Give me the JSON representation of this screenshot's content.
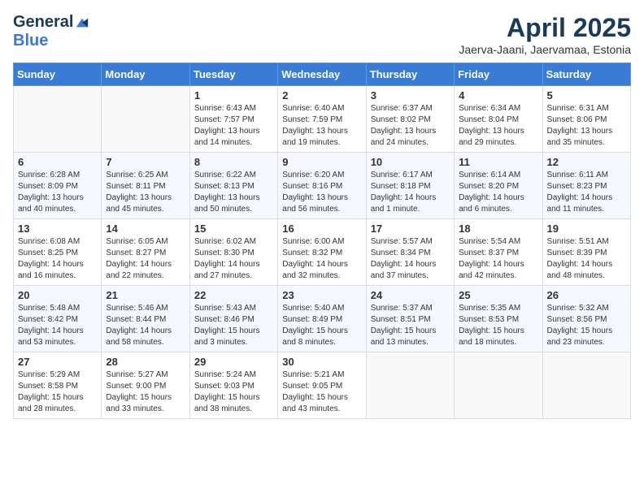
{
  "header": {
    "logo_general": "General",
    "logo_blue": "Blue",
    "month": "April 2025",
    "location": "Jaerva-Jaani, Jaervamaa, Estonia"
  },
  "weekdays": [
    "Sunday",
    "Monday",
    "Tuesday",
    "Wednesday",
    "Thursday",
    "Friday",
    "Saturday"
  ],
  "weeks": [
    [
      {
        "day": "",
        "info": ""
      },
      {
        "day": "",
        "info": ""
      },
      {
        "day": "1",
        "info": "Sunrise: 6:43 AM\nSunset: 7:57 PM\nDaylight: 13 hours and 14 minutes."
      },
      {
        "day": "2",
        "info": "Sunrise: 6:40 AM\nSunset: 7:59 PM\nDaylight: 13 hours and 19 minutes."
      },
      {
        "day": "3",
        "info": "Sunrise: 6:37 AM\nSunset: 8:02 PM\nDaylight: 13 hours and 24 minutes."
      },
      {
        "day": "4",
        "info": "Sunrise: 6:34 AM\nSunset: 8:04 PM\nDaylight: 13 hours and 29 minutes."
      },
      {
        "day": "5",
        "info": "Sunrise: 6:31 AM\nSunset: 8:06 PM\nDaylight: 13 hours and 35 minutes."
      }
    ],
    [
      {
        "day": "6",
        "info": "Sunrise: 6:28 AM\nSunset: 8:09 PM\nDaylight: 13 hours and 40 minutes."
      },
      {
        "day": "7",
        "info": "Sunrise: 6:25 AM\nSunset: 8:11 PM\nDaylight: 13 hours and 45 minutes."
      },
      {
        "day": "8",
        "info": "Sunrise: 6:22 AM\nSunset: 8:13 PM\nDaylight: 13 hours and 50 minutes."
      },
      {
        "day": "9",
        "info": "Sunrise: 6:20 AM\nSunset: 8:16 PM\nDaylight: 13 hours and 56 minutes."
      },
      {
        "day": "10",
        "info": "Sunrise: 6:17 AM\nSunset: 8:18 PM\nDaylight: 14 hours and 1 minute."
      },
      {
        "day": "11",
        "info": "Sunrise: 6:14 AM\nSunset: 8:20 PM\nDaylight: 14 hours and 6 minutes."
      },
      {
        "day": "12",
        "info": "Sunrise: 6:11 AM\nSunset: 8:23 PM\nDaylight: 14 hours and 11 minutes."
      }
    ],
    [
      {
        "day": "13",
        "info": "Sunrise: 6:08 AM\nSunset: 8:25 PM\nDaylight: 14 hours and 16 minutes."
      },
      {
        "day": "14",
        "info": "Sunrise: 6:05 AM\nSunset: 8:27 PM\nDaylight: 14 hours and 22 minutes."
      },
      {
        "day": "15",
        "info": "Sunrise: 6:02 AM\nSunset: 8:30 PM\nDaylight: 14 hours and 27 minutes."
      },
      {
        "day": "16",
        "info": "Sunrise: 6:00 AM\nSunset: 8:32 PM\nDaylight: 14 hours and 32 minutes."
      },
      {
        "day": "17",
        "info": "Sunrise: 5:57 AM\nSunset: 8:34 PM\nDaylight: 14 hours and 37 minutes."
      },
      {
        "day": "18",
        "info": "Sunrise: 5:54 AM\nSunset: 8:37 PM\nDaylight: 14 hours and 42 minutes."
      },
      {
        "day": "19",
        "info": "Sunrise: 5:51 AM\nSunset: 8:39 PM\nDaylight: 14 hours and 48 minutes."
      }
    ],
    [
      {
        "day": "20",
        "info": "Sunrise: 5:48 AM\nSunset: 8:42 PM\nDaylight: 14 hours and 53 minutes."
      },
      {
        "day": "21",
        "info": "Sunrise: 5:46 AM\nSunset: 8:44 PM\nDaylight: 14 hours and 58 minutes."
      },
      {
        "day": "22",
        "info": "Sunrise: 5:43 AM\nSunset: 8:46 PM\nDaylight: 15 hours and 3 minutes."
      },
      {
        "day": "23",
        "info": "Sunrise: 5:40 AM\nSunset: 8:49 PM\nDaylight: 15 hours and 8 minutes."
      },
      {
        "day": "24",
        "info": "Sunrise: 5:37 AM\nSunset: 8:51 PM\nDaylight: 15 hours and 13 minutes."
      },
      {
        "day": "25",
        "info": "Sunrise: 5:35 AM\nSunset: 8:53 PM\nDaylight: 15 hours and 18 minutes."
      },
      {
        "day": "26",
        "info": "Sunrise: 5:32 AM\nSunset: 8:56 PM\nDaylight: 15 hours and 23 minutes."
      }
    ],
    [
      {
        "day": "27",
        "info": "Sunrise: 5:29 AM\nSunset: 8:58 PM\nDaylight: 15 hours and 28 minutes."
      },
      {
        "day": "28",
        "info": "Sunrise: 5:27 AM\nSunset: 9:00 PM\nDaylight: 15 hours and 33 minutes."
      },
      {
        "day": "29",
        "info": "Sunrise: 5:24 AM\nSunset: 9:03 PM\nDaylight: 15 hours and 38 minutes."
      },
      {
        "day": "30",
        "info": "Sunrise: 5:21 AM\nSunset: 9:05 PM\nDaylight: 15 hours and 43 minutes."
      },
      {
        "day": "",
        "info": ""
      },
      {
        "day": "",
        "info": ""
      },
      {
        "day": "",
        "info": ""
      }
    ]
  ]
}
